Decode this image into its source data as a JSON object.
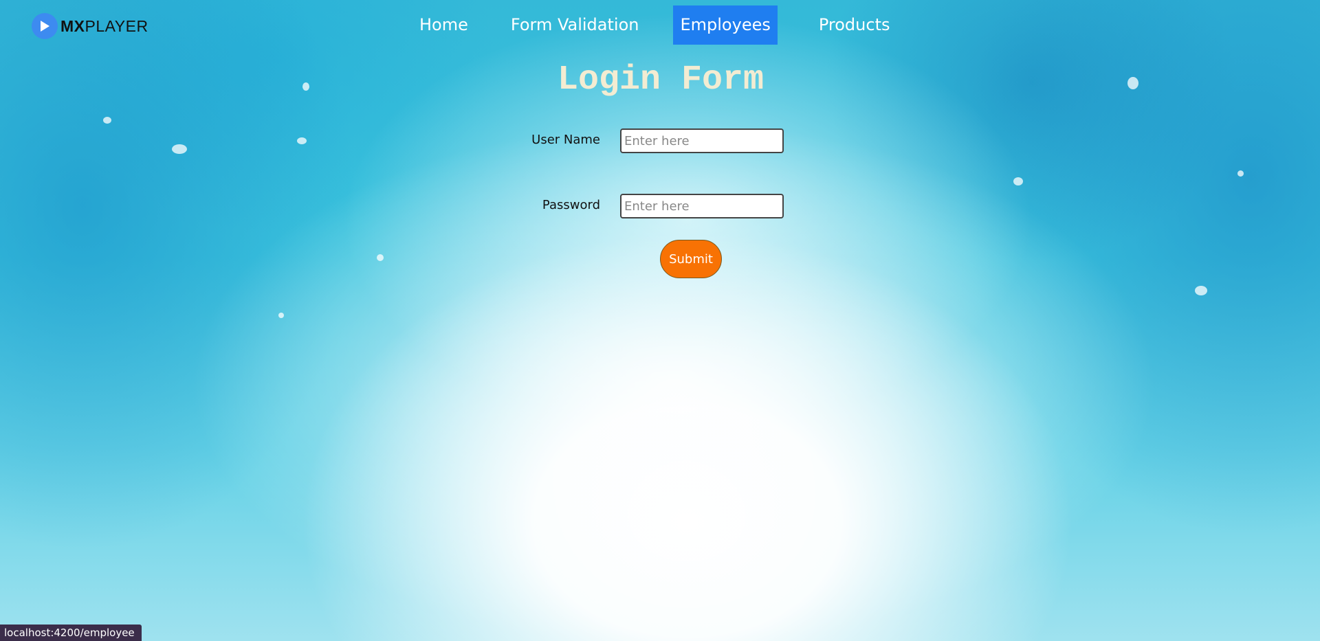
{
  "brand": {
    "logo_bold": "MX",
    "logo_light": "PLAYER",
    "icon": "play-icon",
    "accent": "#3d8bf0"
  },
  "nav": {
    "items": [
      {
        "label": "Home"
      },
      {
        "label": "Form Validation"
      },
      {
        "label": "Employees",
        "active": true
      },
      {
        "label": "Products"
      }
    ],
    "active_color": "#1f7ef0"
  },
  "form": {
    "title": "Login Form",
    "username": {
      "label": "User Name",
      "value": "",
      "placeholder": "Enter here"
    },
    "password": {
      "label": "Password",
      "value": "",
      "placeholder": "Enter here"
    },
    "submit_label": "Submit",
    "submit_color": "#f87204"
  },
  "status_bar": {
    "url": "localhost:4200/employee"
  }
}
